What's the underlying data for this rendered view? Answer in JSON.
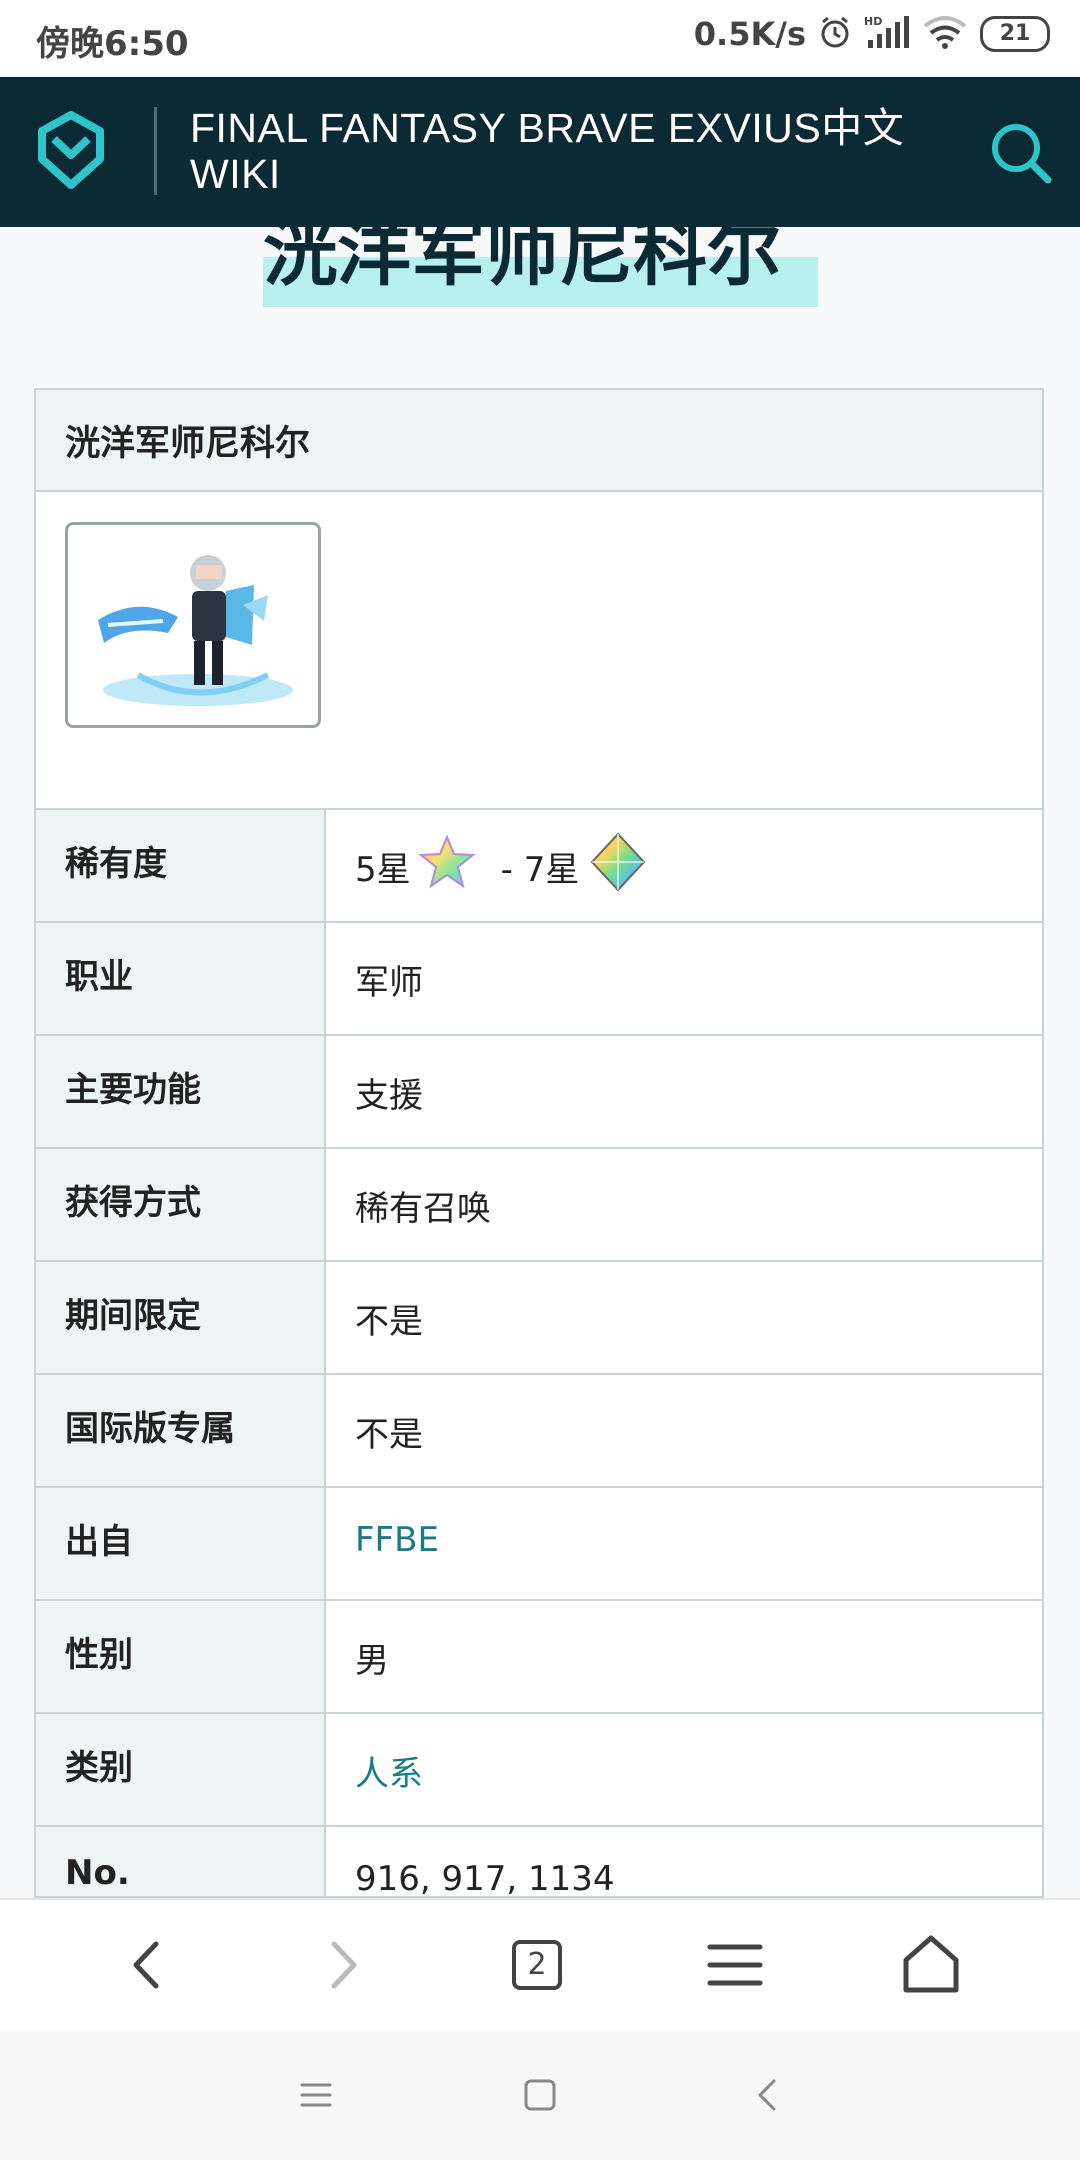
{
  "status_bar": {
    "time": "傍晚6:50",
    "net_speed": "0.5K/s",
    "battery": "21",
    "icons": [
      "alarm-icon",
      "hd-signal-icon",
      "wifi-icon",
      "battery-icon"
    ]
  },
  "header": {
    "site_title": "FINAL FANTASY BRAVE EXVIUS中文WIKI",
    "icons": [
      "wiki-logo-icon",
      "search-icon"
    ],
    "colors": {
      "background": "#0c2a33",
      "accent": "#2ec4c9"
    }
  },
  "page": {
    "title": "洸洋军师尼科尔"
  },
  "infobox": {
    "title": "洸洋军师尼科尔",
    "rarity": {
      "label": "稀有度",
      "from": "5星",
      "separator": "- 7星"
    },
    "rows": [
      {
        "label": "职业",
        "value": "军师"
      },
      {
        "label": "主要功能",
        "value": "支援"
      },
      {
        "label": "获得方式",
        "value": "稀有召唤"
      },
      {
        "label": "期间限定",
        "value": "不是"
      },
      {
        "label": "国际版专属",
        "value": "不是"
      },
      {
        "label": "出自",
        "value": "FFBE"
      },
      {
        "label": "性别",
        "value": "男"
      },
      {
        "label": "类别",
        "value": "人系"
      },
      {
        "label": "No.",
        "value": "916, 917, 1134"
      }
    ],
    "link_color": "#197b84"
  },
  "toolbar": {
    "tab_count": "2",
    "icons": [
      "back-icon",
      "forward-icon",
      "tabs-icon",
      "menu-icon",
      "home-icon"
    ]
  },
  "navbar": {
    "icons": [
      "nav-menu-icon",
      "nav-home-icon",
      "nav-back-icon"
    ]
  }
}
